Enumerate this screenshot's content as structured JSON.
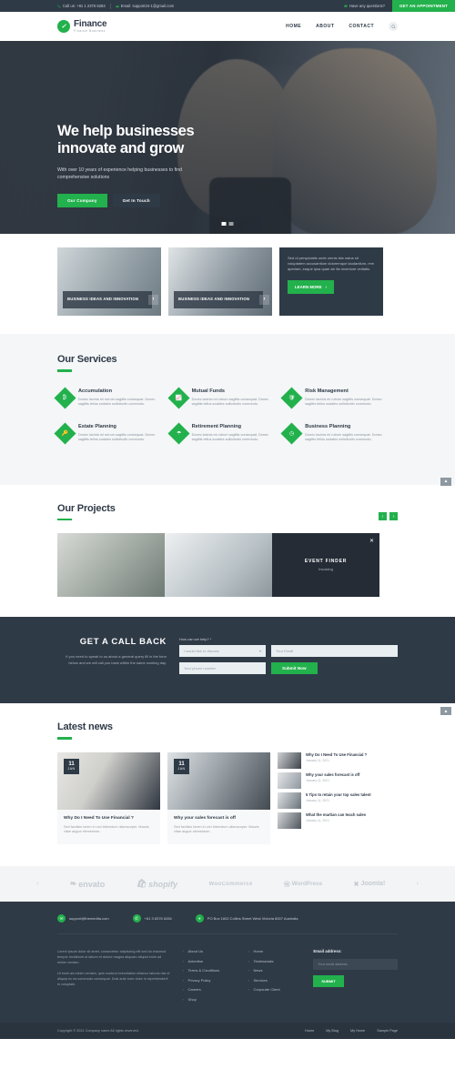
{
  "topbar": {
    "phone": "Call us: +91 1 2376 6284",
    "email": "Email: support24-1@gmail.com",
    "question": "Have any questions?",
    "cta": "GET AN APPOINTMENT",
    "phone_icon": "phone-icon",
    "email_icon": "mail-icon",
    "question_icon": "chat-icon"
  },
  "header": {
    "logo_mark": "check-circle-icon",
    "logo_name": "Finance",
    "logo_tagline": "Finance Business",
    "nav": [
      {
        "label": "HOME"
      },
      {
        "label": "ABOUT"
      },
      {
        "label": "CONTACT"
      }
    ],
    "search_icon": "search-icon"
  },
  "hero": {
    "title_line1": "We help businesses",
    "title_line2": "innovate and grow",
    "subtitle": "With over 10 years of experience helping businesses to find comprehensive solutions",
    "btn_primary": "Our Company",
    "btn_secondary": "Get In Touch",
    "slides": 2,
    "active_slide": 1
  },
  "features": [
    {
      "title": "BUSINESS IDEAS AND INNOVATION",
      "arrow_icon": "chevron-right-icon"
    },
    {
      "title": "BUSINESS IDEAS AND INNOVATION",
      "arrow_icon": "chevron-right-icon"
    }
  ],
  "feature_panel": {
    "text": "Sed ut perspiciatis unde omnis iste natus sit voluptatem accusantium doloremque laudantium, rem aperiam, eaque ipsa quae ab illo inventore veritatis",
    "button": "LEARN MORE",
    "button_icon": "chevron-right-icon"
  },
  "services": {
    "title": "Our Services",
    "items": [
      {
        "name": "Accumulation",
        "desc": "Donec lacinia mi rutrum sagittis consequat. Donec sagittis tellus sodales sollicitudin commodo.",
        "icon": "money-icon"
      },
      {
        "name": "Mutual Funds",
        "desc": "Donec lacinia mi rutrum sagittis consequat. Donec sagittis tellus sodales sollicitudin commodo.",
        "icon": "chart-line-icon"
      },
      {
        "name": "Risk Management",
        "desc": "Donec lacinia mi rutrum sagittis consequat. Donec sagittis tellus sodales sollicitudin commodo.",
        "icon": "shield-icon"
      },
      {
        "name": "Estate Planning",
        "desc": "Donec lacinia mi rutrum sagittis consequat. Donec sagittis tellus sodales sollicitudin commodo.",
        "icon": "key-icon"
      },
      {
        "name": "Retirement Planning",
        "desc": "Donec lacinia mi rutrum sagittis consequat. Donec sagittis tellus sodales sollicitudin commodo.",
        "icon": "umbrella-icon"
      },
      {
        "name": "Business Planning",
        "desc": "Donec lacinia mi rutrum sagittis consequat. Donec sagittis tellus sodales sollicitudin commodo.",
        "icon": "clock-icon"
      }
    ]
  },
  "projects": {
    "title": "Our Projects",
    "prev_icon": "chevron-left-icon",
    "next_icon": "chevron-right-icon",
    "overlay_title": "EVENT FINDER",
    "overlay_sub": "Invoicing",
    "close_icon": "close-icon"
  },
  "callback": {
    "title": "GET A CALL BACK",
    "desc": "If you need to speak to us about a general query fill in the form below and we will call you back within the same working day.",
    "form_label": "How can we help? *",
    "select_value": "I would like to discuss",
    "select_icon": "chevron-down-icon",
    "email_placeholder": "Your Email",
    "phone_placeholder": "Your phone number",
    "submit_label": "Submit Now"
  },
  "news": {
    "title": "Latest news",
    "cards": [
      {
        "day": "11",
        "month": "JAN",
        "title": "Why Do I Need To Use Financial ?",
        "excerpt": "Sed facilisis lorem in orci bibendum ullamcorper. Mauris vitae augue elementum."
      },
      {
        "day": "11",
        "month": "JAN",
        "title": "Why your sales forecast is off",
        "excerpt": "Sed facilisis lorem in orci bibendum ullamcorper. Mauris vitae augue elementum."
      }
    ],
    "list": [
      {
        "title": "Why Do I Need To Use Financial ?",
        "date": "January 11, 2021"
      },
      {
        "title": "Why your sales forecast is off",
        "date": "January 11, 2021"
      },
      {
        "title": "5 Tips to retain your top sales talent",
        "date": "January 11, 2021"
      },
      {
        "title": "What the martian can teach sales",
        "date": "January 11, 2021"
      }
    ]
  },
  "brands": {
    "prev_icon": "chevron-left-icon",
    "next_icon": "chevron-right-icon",
    "items": [
      {
        "name": "envato"
      },
      {
        "name": "shopify"
      },
      {
        "name": "WooCommerce"
      },
      {
        "name": "WordPress"
      },
      {
        "name": "Joomla!"
      }
    ]
  },
  "footer": {
    "contacts": [
      {
        "icon": "mail-icon",
        "text": "support@themedita.com"
      },
      {
        "icon": "phone-icon",
        "text": "+61 3 8376 6284"
      },
      {
        "icon": "location-icon",
        "text": "PO Box 1602 Collins Street West Victoria 8007 Australia"
      }
    ],
    "about_p1": "Lorem ipsum dolor sit amet, consectetur adipiscing elit sed do eiusmod tempor incididunt ut labore et dolore magna aliquam aliquid enim ad minim veniam.",
    "about_p2": "Ut enim ad minim veniam, quis nostrud exercitation ullamco laboris nisi ut aliquip ex ea commodo consequat. Duis aute irure dolor in reprehenderit in voluptate.",
    "col1": [
      {
        "label": "About Us"
      },
      {
        "label": "Advertise"
      },
      {
        "label": "Terms & Conditions"
      },
      {
        "label": "Privacy Policy"
      },
      {
        "label": "Careers"
      },
      {
        "label": "Shop"
      }
    ],
    "col2": [
      {
        "label": "Home"
      },
      {
        "label": "Testimonials"
      },
      {
        "label": "News"
      },
      {
        "label": "Services"
      },
      {
        "label": "Corporate Client"
      }
    ],
    "subscribe_title": "Email address:",
    "subscribe_placeholder": "Your email address",
    "subscribe_button": "SUBMIT",
    "copyright": "Copyright © 2021 Company name All rights reserved.",
    "bottom_links": [
      {
        "label": "Home"
      },
      {
        "label": "My Blog"
      },
      {
        "label": "My Home"
      },
      {
        "label": "Sample Page"
      }
    ]
  },
  "scroll_top_icon": "arrow-up-icon",
  "colors": {
    "accent": "#22b14c",
    "dark": "#2f3a47",
    "light": "#f4f6f8"
  }
}
